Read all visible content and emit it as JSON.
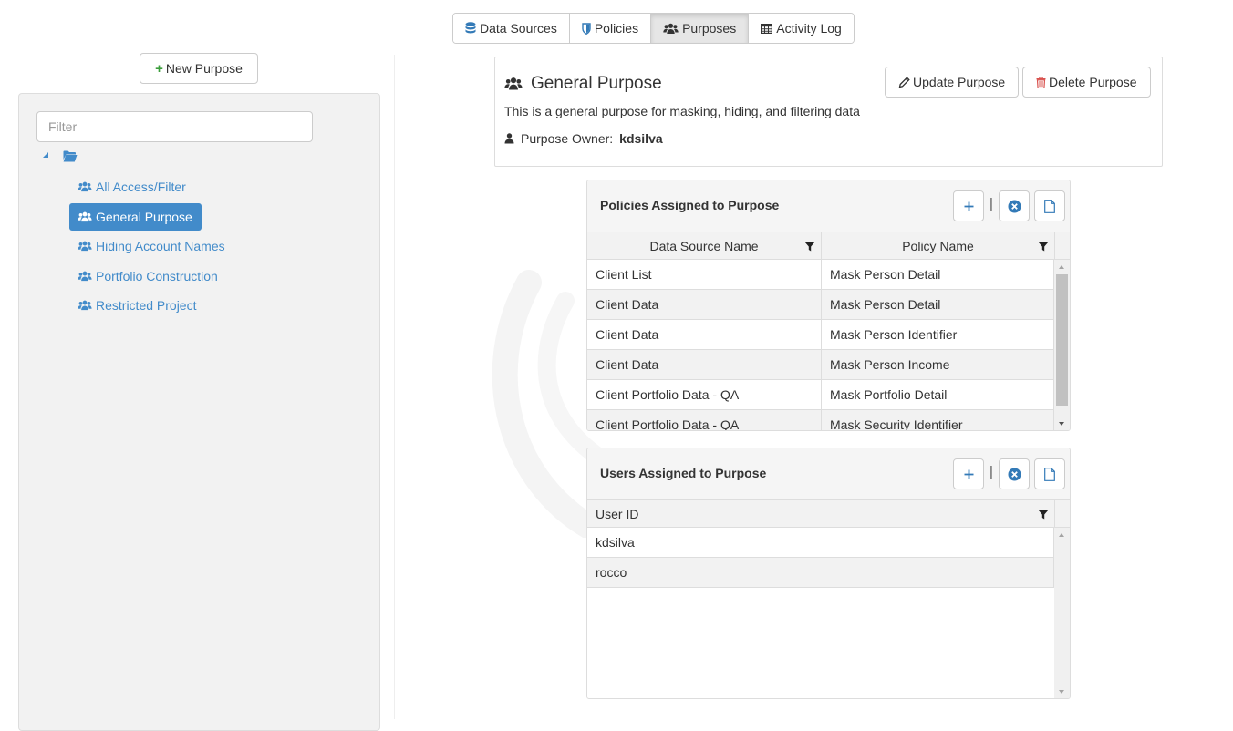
{
  "nav": {
    "tabs": [
      {
        "label": "Data Sources",
        "icon": "database-icon"
      },
      {
        "label": "Policies",
        "icon": "shield-icon"
      },
      {
        "label": "Purposes",
        "icon": "users-icon",
        "active": true
      },
      {
        "label": "Activity Log",
        "icon": "table-icon"
      }
    ]
  },
  "sidebar": {
    "new_button_label": "New Purpose",
    "filter_placeholder": "Filter",
    "items": [
      {
        "label": "All Access/Filter"
      },
      {
        "label": "General Purpose",
        "selected": true
      },
      {
        "label": "Hiding Account Names"
      },
      {
        "label": "Portfolio Construction"
      },
      {
        "label": "Restricted Project"
      }
    ]
  },
  "purpose": {
    "title": "General Purpose",
    "description": "This is a general purpose for masking, hiding, and filtering data",
    "owner_label": "Purpose Owner:",
    "owner_name": "kdsilva",
    "update_label": "Update Purpose",
    "delete_label": "Delete Purpose"
  },
  "policies_grid": {
    "title": "Policies Assigned to Purpose",
    "columns": [
      "Data Source Name",
      "Policy Name"
    ],
    "rows": [
      [
        "Client List",
        "Mask Person Detail"
      ],
      [
        "Client Data",
        "Mask Person Detail"
      ],
      [
        "Client Data",
        "Mask Person Identifier"
      ],
      [
        "Client Data",
        "Mask Person Income"
      ],
      [
        "Client Portfolio Data - QA",
        "Mask Portfolio Detail"
      ],
      [
        "Client Portfolio Data - QA",
        "Mask Security Identifier"
      ]
    ]
  },
  "users_grid": {
    "title": "Users Assigned to Purpose",
    "columns": [
      "User ID"
    ],
    "rows": [
      [
        "kdsilva"
      ],
      [
        "rocco"
      ]
    ]
  },
  "colors": {
    "accent": "#428bca",
    "add_green": "#3c9e3c",
    "delete_red": "#d9534f",
    "icon_blue": "#337ab7"
  }
}
